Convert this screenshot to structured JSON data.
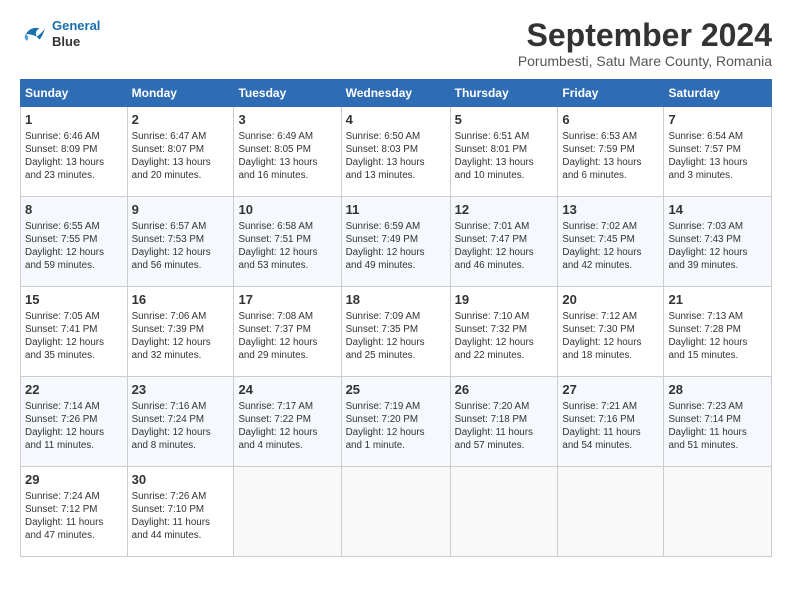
{
  "header": {
    "logo_line1": "General",
    "logo_line2": "Blue",
    "title": "September 2024",
    "location": "Porumbesti, Satu Mare County, Romania"
  },
  "weekdays": [
    "Sunday",
    "Monday",
    "Tuesday",
    "Wednesday",
    "Thursday",
    "Friday",
    "Saturday"
  ],
  "weeks": [
    [
      {
        "day": "1",
        "info": "Sunrise: 6:46 AM\nSunset: 8:09 PM\nDaylight: 13 hours\nand 23 minutes."
      },
      {
        "day": "2",
        "info": "Sunrise: 6:47 AM\nSunset: 8:07 PM\nDaylight: 13 hours\nand 20 minutes."
      },
      {
        "day": "3",
        "info": "Sunrise: 6:49 AM\nSunset: 8:05 PM\nDaylight: 13 hours\nand 16 minutes."
      },
      {
        "day": "4",
        "info": "Sunrise: 6:50 AM\nSunset: 8:03 PM\nDaylight: 13 hours\nand 13 minutes."
      },
      {
        "day": "5",
        "info": "Sunrise: 6:51 AM\nSunset: 8:01 PM\nDaylight: 13 hours\nand 10 minutes."
      },
      {
        "day": "6",
        "info": "Sunrise: 6:53 AM\nSunset: 7:59 PM\nDaylight: 13 hours\nand 6 minutes."
      },
      {
        "day": "7",
        "info": "Sunrise: 6:54 AM\nSunset: 7:57 PM\nDaylight: 13 hours\nand 3 minutes."
      }
    ],
    [
      {
        "day": "8",
        "info": "Sunrise: 6:55 AM\nSunset: 7:55 PM\nDaylight: 12 hours\nand 59 minutes."
      },
      {
        "day": "9",
        "info": "Sunrise: 6:57 AM\nSunset: 7:53 PM\nDaylight: 12 hours\nand 56 minutes."
      },
      {
        "day": "10",
        "info": "Sunrise: 6:58 AM\nSunset: 7:51 PM\nDaylight: 12 hours\nand 53 minutes."
      },
      {
        "day": "11",
        "info": "Sunrise: 6:59 AM\nSunset: 7:49 PM\nDaylight: 12 hours\nand 49 minutes."
      },
      {
        "day": "12",
        "info": "Sunrise: 7:01 AM\nSunset: 7:47 PM\nDaylight: 12 hours\nand 46 minutes."
      },
      {
        "day": "13",
        "info": "Sunrise: 7:02 AM\nSunset: 7:45 PM\nDaylight: 12 hours\nand 42 minutes."
      },
      {
        "day": "14",
        "info": "Sunrise: 7:03 AM\nSunset: 7:43 PM\nDaylight: 12 hours\nand 39 minutes."
      }
    ],
    [
      {
        "day": "15",
        "info": "Sunrise: 7:05 AM\nSunset: 7:41 PM\nDaylight: 12 hours\nand 35 minutes."
      },
      {
        "day": "16",
        "info": "Sunrise: 7:06 AM\nSunset: 7:39 PM\nDaylight: 12 hours\nand 32 minutes."
      },
      {
        "day": "17",
        "info": "Sunrise: 7:08 AM\nSunset: 7:37 PM\nDaylight: 12 hours\nand 29 minutes."
      },
      {
        "day": "18",
        "info": "Sunrise: 7:09 AM\nSunset: 7:35 PM\nDaylight: 12 hours\nand 25 minutes."
      },
      {
        "day": "19",
        "info": "Sunrise: 7:10 AM\nSunset: 7:32 PM\nDaylight: 12 hours\nand 22 minutes."
      },
      {
        "day": "20",
        "info": "Sunrise: 7:12 AM\nSunset: 7:30 PM\nDaylight: 12 hours\nand 18 minutes."
      },
      {
        "day": "21",
        "info": "Sunrise: 7:13 AM\nSunset: 7:28 PM\nDaylight: 12 hours\nand 15 minutes."
      }
    ],
    [
      {
        "day": "22",
        "info": "Sunrise: 7:14 AM\nSunset: 7:26 PM\nDaylight: 12 hours\nand 11 minutes."
      },
      {
        "day": "23",
        "info": "Sunrise: 7:16 AM\nSunset: 7:24 PM\nDaylight: 12 hours\nand 8 minutes."
      },
      {
        "day": "24",
        "info": "Sunrise: 7:17 AM\nSunset: 7:22 PM\nDaylight: 12 hours\nand 4 minutes."
      },
      {
        "day": "25",
        "info": "Sunrise: 7:19 AM\nSunset: 7:20 PM\nDaylight: 12 hours\nand 1 minute."
      },
      {
        "day": "26",
        "info": "Sunrise: 7:20 AM\nSunset: 7:18 PM\nDaylight: 11 hours\nand 57 minutes."
      },
      {
        "day": "27",
        "info": "Sunrise: 7:21 AM\nSunset: 7:16 PM\nDaylight: 11 hours\nand 54 minutes."
      },
      {
        "day": "28",
        "info": "Sunrise: 7:23 AM\nSunset: 7:14 PM\nDaylight: 11 hours\nand 51 minutes."
      }
    ],
    [
      {
        "day": "29",
        "info": "Sunrise: 7:24 AM\nSunset: 7:12 PM\nDaylight: 11 hours\nand 47 minutes."
      },
      {
        "day": "30",
        "info": "Sunrise: 7:26 AM\nSunset: 7:10 PM\nDaylight: 11 hours\nand 44 minutes."
      },
      {
        "day": "",
        "info": ""
      },
      {
        "day": "",
        "info": ""
      },
      {
        "day": "",
        "info": ""
      },
      {
        "day": "",
        "info": ""
      },
      {
        "day": "",
        "info": ""
      }
    ]
  ]
}
